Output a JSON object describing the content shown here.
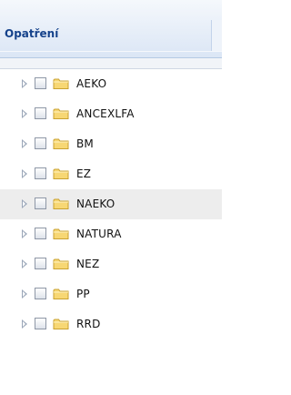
{
  "panel": {
    "title": "Opatření"
  },
  "tree": {
    "items": [
      {
        "label": "AEKO",
        "checked": false,
        "highlighted": false
      },
      {
        "label": "ANCEXLFA",
        "checked": false,
        "highlighted": false
      },
      {
        "label": "BM",
        "checked": false,
        "highlighted": false
      },
      {
        "label": "EZ",
        "checked": false,
        "highlighted": false
      },
      {
        "label": "NAEKO",
        "checked": false,
        "highlighted": true
      },
      {
        "label": "NATURA",
        "checked": false,
        "highlighted": false
      },
      {
        "label": "NEZ",
        "checked": false,
        "highlighted": false
      },
      {
        "label": "PP",
        "checked": false,
        "highlighted": false
      },
      {
        "label": "RRD",
        "checked": false,
        "highlighted": false
      }
    ]
  },
  "colors": {
    "title": "#15428b",
    "highlight_row": "#ededed",
    "folder_fill": "#f7d774",
    "folder_stroke": "#c9a230"
  },
  "icons": {
    "expander": "triangle-right-icon",
    "checkbox": "checkbox-icon",
    "folder": "folder-icon"
  }
}
